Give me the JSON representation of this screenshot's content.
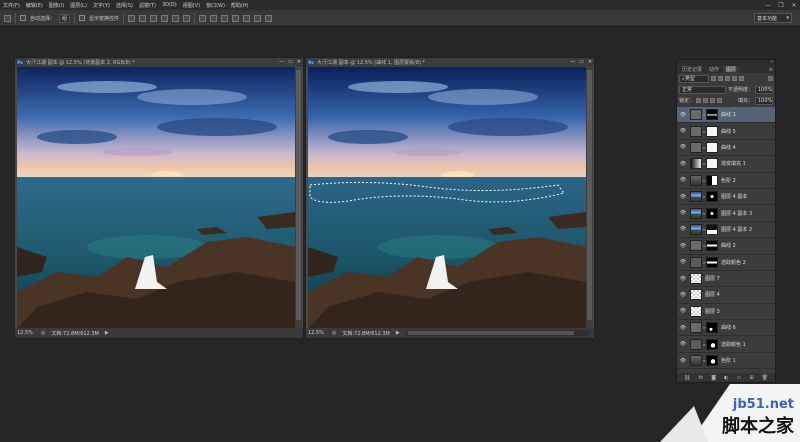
{
  "menubar": {
    "items": [
      "文件(F)",
      "编辑(E)",
      "图像(I)",
      "图层(L)",
      "文字(Y)",
      "选择(S)",
      "滤镜(T)",
      "3D(D)",
      "视图(V)",
      "窗口(W)",
      "帮助(H)"
    ],
    "minimize": "—",
    "restore": "❐",
    "close": "✕"
  },
  "options": {
    "auto_select_label": "自动选择：",
    "auto_select_value": "组",
    "show_transform_label": "显示变换控件",
    "workspace": "基本功能"
  },
  "doc_left": {
    "badge": "Ps",
    "title": "大汗江湖 副本 @ 12.5% (背景副本 2, RGB/8) *",
    "zoom": "12.5%",
    "doc_size": "文档:72.8M/612.3M"
  },
  "doc_right": {
    "badge": "Ps",
    "title": "大汗江湖 副本 @ 12.5% (曲线 1, 图层蒙版/8) *",
    "zoom": "12.5%",
    "doc_size": "文档:72.8M/612.3M"
  },
  "window_ctrls": {
    "min": "—",
    "max": "▭",
    "close": "✕"
  },
  "panel": {
    "tabs": [
      "历史记录",
      "动作",
      "图层"
    ],
    "active_tab": 2,
    "kind_label": "类型",
    "blend_mode": "正常",
    "opacity_label": "不透明度：",
    "opacity_value": "100%",
    "lock_label": "锁定：",
    "fill_label": "填充：",
    "fill_value": "100%",
    "layers": [
      {
        "name": "曲线 1",
        "thumb": "curves",
        "mask": "black-sky",
        "selected": true
      },
      {
        "name": "曲线 5",
        "thumb": "curves",
        "mask": "white",
        "selected": false
      },
      {
        "name": "曲线 4",
        "thumb": "curves",
        "mask": "white",
        "selected": false
      },
      {
        "name": "渐变填充 1",
        "thumb": "gradient",
        "mask": "white",
        "selected": false
      },
      {
        "name": "色阶 2",
        "thumb": "levels",
        "mask": "black-split",
        "selected": false
      },
      {
        "name": "图层 4 副本",
        "thumb": "photo",
        "mask": "black-small",
        "selected": false
      },
      {
        "name": "图层 4 副本 3",
        "thumb": "photo",
        "mask": "black-small",
        "selected": false
      },
      {
        "name": "图层 4 副本 2",
        "thumb": "photo",
        "mask": "white-bottom",
        "selected": false
      },
      {
        "name": "曲线 2",
        "thumb": "curves",
        "mask": "black-stripe",
        "selected": false
      },
      {
        "name": "选取颜色 2",
        "thumb": "selective",
        "mask": "black-stripe",
        "selected": false
      },
      {
        "name": "图层 7",
        "thumb": "checker",
        "mask": "none",
        "selected": false
      },
      {
        "name": "图层 4",
        "thumb": "checker",
        "mask": "none",
        "selected": false
      },
      {
        "name": "图层 3",
        "thumb": "checker",
        "mask": "none",
        "selected": false
      },
      {
        "name": "曲线 6",
        "thumb": "curves",
        "mask": "black-dot",
        "selected": false
      },
      {
        "name": "选取颜色 1",
        "thumb": "selective",
        "mask": "black-shape",
        "selected": false
      },
      {
        "name": "色阶 1",
        "thumb": "levels",
        "mask": "black-shape",
        "selected": false
      }
    ],
    "footer_icons": [
      "link-icon",
      "fx-icon",
      "mask-icon",
      "adjustment-icon",
      "folder-icon",
      "new-layer-icon",
      "trash-icon"
    ]
  },
  "watermark": {
    "line1": "jb51.net",
    "line2": "脚本之家"
  },
  "colors": {
    "accent": "#566275",
    "sky_top": "#0f2a66",
    "sea": "#1f5a6e",
    "rock": "#4a3426"
  }
}
